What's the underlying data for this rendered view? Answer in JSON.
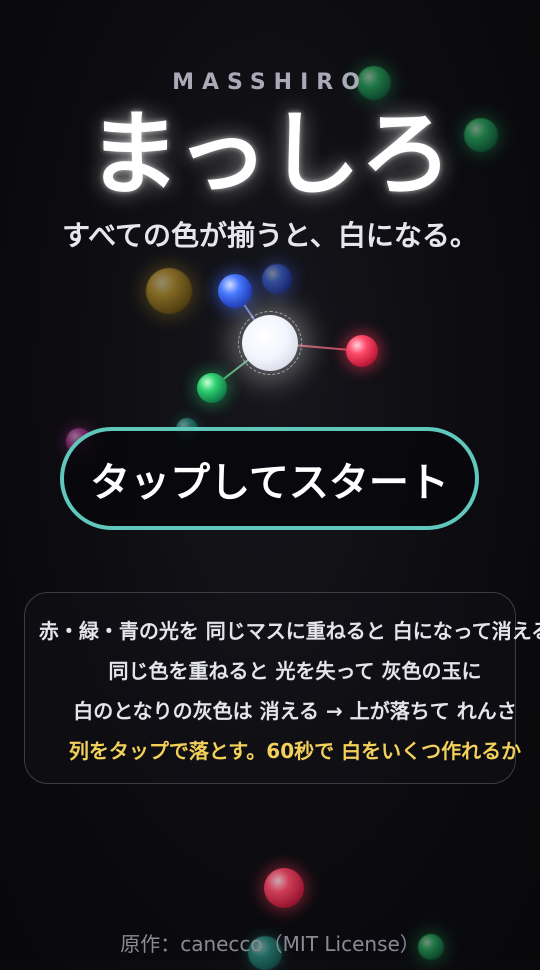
{
  "header": {
    "subtitle_en": "MASSHIRO",
    "title_jp": "まっしろ",
    "tagline": "すべての色が揃うと、白になる。"
  },
  "start_button": {
    "label": "タップしてスタート"
  },
  "rules": {
    "lines": [
      "赤・緑・青の光を 同じマスに重ねると 白になって消える",
      "同じ色を重ねると 光を失って 灰色の玉に",
      "白のとなりの灰色は 消える → 上が落ちて れんさ",
      "列をタップで落とす。60秒で 白をいくつ作れるか"
    ]
  },
  "credit": "原作：canecco（MIT License）",
  "colors": {
    "accent_border": "#5fc7bc",
    "highlight_text": "#f2d05a",
    "orb_red": "#ff4a6a",
    "orb_green": "#2fd070",
    "orb_blue": "#4a7aff",
    "orb_yellow": "#e0b030",
    "orb_white": "#ffffff"
  }
}
